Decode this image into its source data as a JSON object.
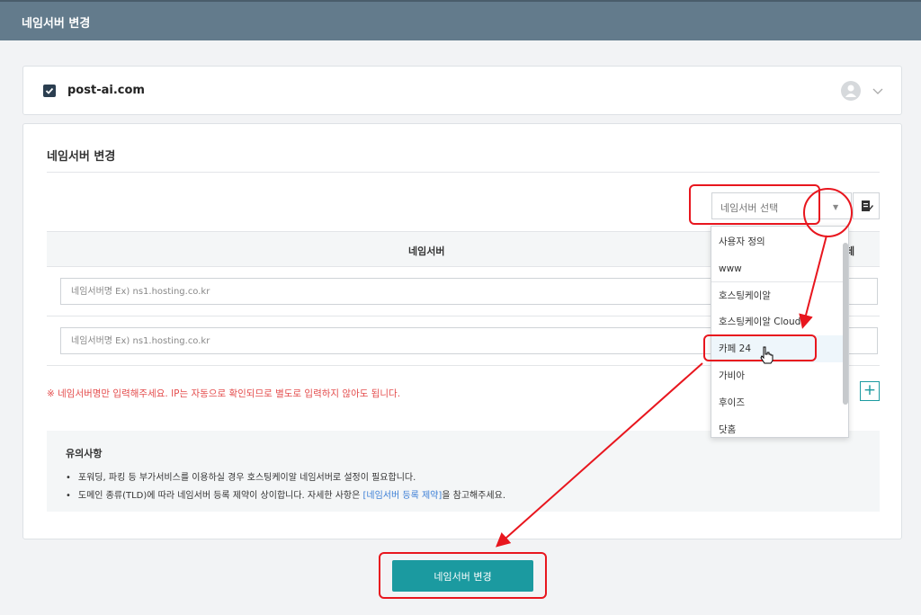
{
  "header": {
    "title": "네임서버 변경"
  },
  "domain": {
    "name": "post-ai.com",
    "checked": true
  },
  "section": {
    "title": "네임서버 변경"
  },
  "select": {
    "placeholder": "네임서버 선택"
  },
  "table": {
    "header": "네임서버",
    "header_partial": "데",
    "rows": [
      {
        "placeholder": "네임서버명 Ex) ns1.hosting.co.kr",
        "value": ""
      },
      {
        "placeholder": "네임서버명 Ex) ns1.hosting.co.kr",
        "value": ""
      }
    ]
  },
  "warning": "※ 네임서버명만 입력해주세요. IP는 자동으로 확인되므로 별도로 입력하지 않아도 됩니다.",
  "plus_label": "+",
  "notice": {
    "title": "유의사항",
    "item1": "포워딩, 파킹 등 부가서비스를 이용하실 경우 호스팅케이알 네임서버로 설정이 필요합니다.",
    "item2_pre": "도메인 종류(TLD)에 따라 네임서버 등록 제약이 상이합니다. 자세한 사항은 ",
    "item2_link": "[네임서버 등록 제약]",
    "item2_post": "을 참고해주세요."
  },
  "dropdown": {
    "options": [
      "사용자 정의",
      "www",
      "호스팅케이알",
      "호스팅케이알 Cloud",
      "카페 24",
      "가비아",
      "후이즈",
      "닷홈"
    ],
    "selected_index": 4
  },
  "submit_label": "네임서버 변경",
  "colors": {
    "accent": "#1b9aa0",
    "header_bg": "#637b8c",
    "highlight": "#e8161e",
    "warning": "#e44d4d"
  }
}
